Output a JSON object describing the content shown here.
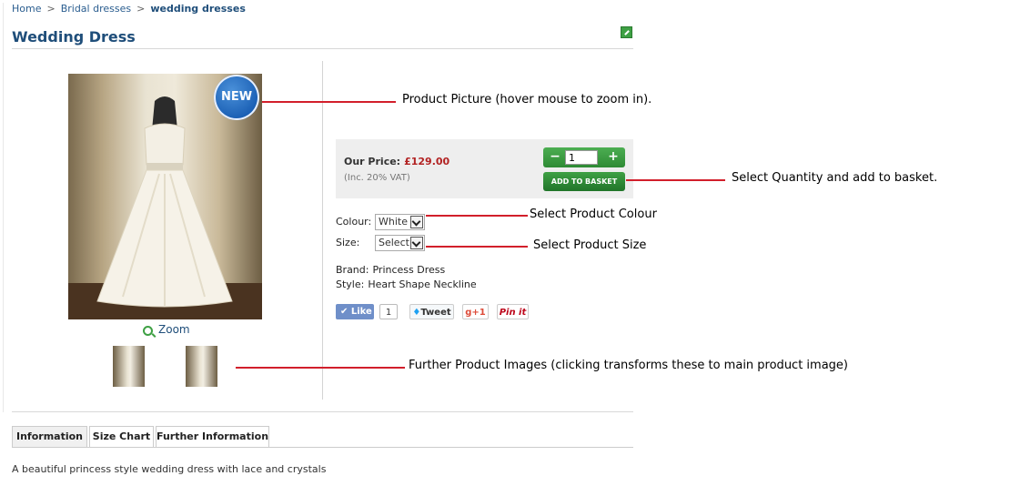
{
  "breadcrumb": {
    "home": "Home",
    "separator": ">",
    "category": "Bridal dresses",
    "current": "wedding dresses"
  },
  "page": {
    "title": "Wedding Dress"
  },
  "product": {
    "badge": "NEW",
    "zoom_label": "Zoom",
    "price_label": "Our Price:",
    "price_value": "£129.00",
    "vat_note": "(Inc. 20% VAT)",
    "quantity": "1",
    "qty_minus": "−",
    "qty_plus": "+",
    "add_to_basket": "ADD TO BASKET",
    "colour_label": "Colour:",
    "colour_value": "White",
    "size_label": "Size:",
    "size_value": "Select:",
    "brand_label": "Brand:",
    "brand_value": "Princess Dress",
    "style_label": "Style:",
    "style_value": "Heart Shape Neckline",
    "description": "A beautiful princess style wedding dress with lace and crystals"
  },
  "social": {
    "like": "Like",
    "like_count": "1",
    "tweet": "Tweet",
    "gplus": "+1",
    "pin": "Pin it"
  },
  "tabs": [
    {
      "label": "Information",
      "active": true
    },
    {
      "label": "Size Chart",
      "active": false
    },
    {
      "label": "Further Information",
      "active": false
    }
  ],
  "annotations": {
    "picture": "Product Picture (hover mouse to zoom in).",
    "basket": "Select Quantity and add to basket.",
    "colour": "Select Product Colour",
    "size": "Select Product Size",
    "images": "Further Product Images (clicking transforms these to main product image)"
  },
  "colors": {
    "accent": "#1f4e7a",
    "price": "#b22222",
    "button": "#3ea044",
    "annotation_line": "#d21f2b"
  }
}
